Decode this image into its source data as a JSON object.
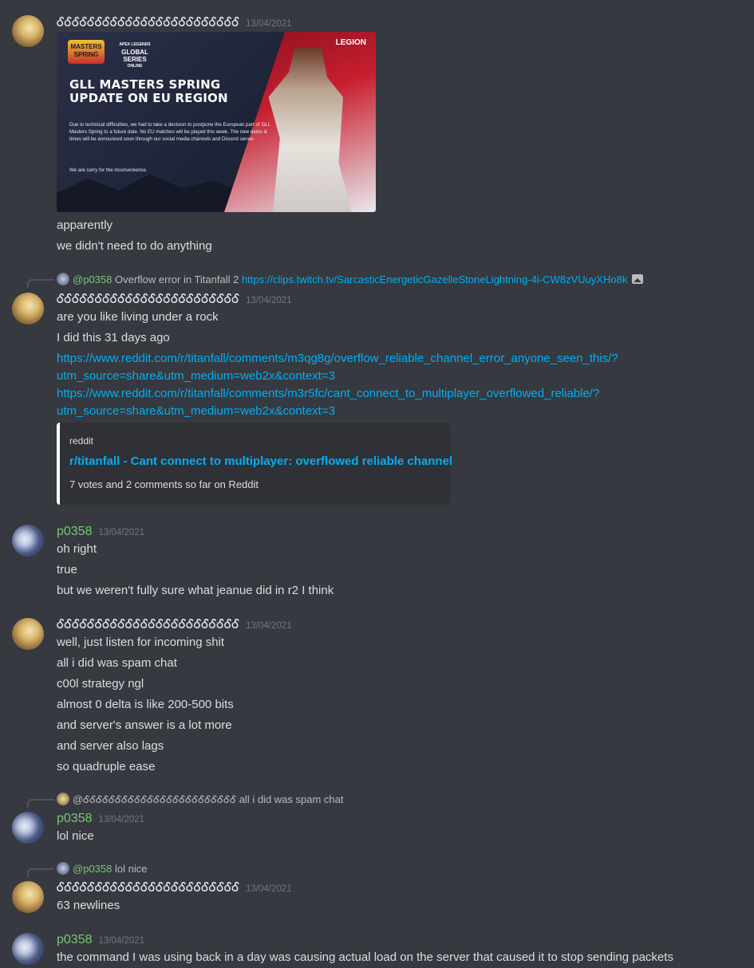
{
  "messages": [
    {
      "author": "ᎴᎴᎴᎴᎴᎴᎴᎴᎴᎴᎴᎴᎴᎴᎴᎴᎴᎴᎴᎴᎴᎴᎴᎴ",
      "timestamp": "13/04/2021",
      "image": {
        "logo_top": "MASTERS SPRING",
        "series_line1": "APEX LEGENDS",
        "series_line2": "GLOBAL SERIES",
        "series_line3": "ONLINE",
        "brand": "LEGION",
        "title": "GLL MASTERS SPRING\nUPDATE ON EU REGION",
        "body": "Due to technical difficulties, we had to take a decision to postpone the European part of GLL Masters Spring to a future date. No EU matches will be played this week. The new dates & times will be announced soon through our social media channels and Discord server.",
        "sorry": "We are sorry for the inconvenience."
      },
      "lines": [
        "apparently",
        "we didn't need to do anything"
      ]
    },
    {
      "reply": {
        "mention": "@p0358",
        "text": "Overflow error in Titanfall 2",
        "link": "https://clips.twitch.tv/SarcasticEnergeticGazelleStoneLightning-4i-CW8zVUuyXHo8k"
      },
      "author": "ᎴᎴᎴᎴᎴᎴᎴᎴᎴᎴᎴᎴᎴᎴᎴᎴᎴᎴᎴᎴᎴᎴᎴᎴ",
      "timestamp": "13/04/2021",
      "lines": [
        "are you like living under a rock",
        "I did this 31 days ago"
      ],
      "links": [
        "https://www.reddit.com/r/titanfall/comments/m3qg8g/overflow_reliable_channel_error_anyone_seen_this/?",
        "utm_source=share&utm_medium=web2x&context=3",
        "https://www.reddit.com/r/titanfall/comments/m3r5fc/cant_connect_to_multiplayer_overflowed_reliable/?",
        "utm_source=share&utm_medium=web2x&context=3"
      ],
      "embed": {
        "provider": "reddit",
        "title": "r/titanfall - Cant connect to multiplayer: overflowed reliable channel",
        "description": "7 votes and 2 comments so far on Reddit"
      }
    },
    {
      "author": "p0358",
      "timestamp": "13/04/2021",
      "lines": [
        "oh right",
        "true",
        "but we weren't fully sure what jeanue did in r2 I think"
      ]
    },
    {
      "author": "ᎴᎴᎴᎴᎴᎴᎴᎴᎴᎴᎴᎴᎴᎴᎴᎴᎴᎴᎴᎴᎴᎴᎴᎴ",
      "timestamp": "13/04/2021",
      "lines": [
        "well, just listen for incoming shit",
        "all i did was spam chat",
        "c00l strategy ngl",
        "almost 0 delta is like 200-500 bits",
        "and server's answer is a lot more",
        "and server also lags",
        "so quadruple ease"
      ]
    },
    {
      "reply": {
        "mention": "@ᎴᎴᎴᎴᎴᎴᎴᎴᎴᎴᎴᎴᎴᎴᎴᎴᎴᎴᎴᎴᎴᎴᎴᎴ",
        "text": "all i did was spam chat"
      },
      "author": "p0358",
      "timestamp": "13/04/2021",
      "lines": [
        "lol nice"
      ]
    },
    {
      "reply": {
        "mention": "@p0358",
        "text": "lol nice"
      },
      "author": "ᎴᎴᎴᎴᎴᎴᎴᎴᎴᎴᎴᎴᎴᎴᎴᎴᎴᎴᎴᎴᎴᎴᎴᎴ",
      "timestamp": "13/04/2021",
      "lines": [
        "63 newlines"
      ]
    },
    {
      "author": "p0358",
      "timestamp": "13/04/2021",
      "lines": [
        "the command I was using back in a day was causing actual load on the server that caused it to stop sending packets"
      ]
    }
  ],
  "colors": {
    "background": "#36393f",
    "link": "#00aff4",
    "green_user": "#79c67a",
    "text": "#dcddde",
    "timestamp": "#72767d"
  }
}
